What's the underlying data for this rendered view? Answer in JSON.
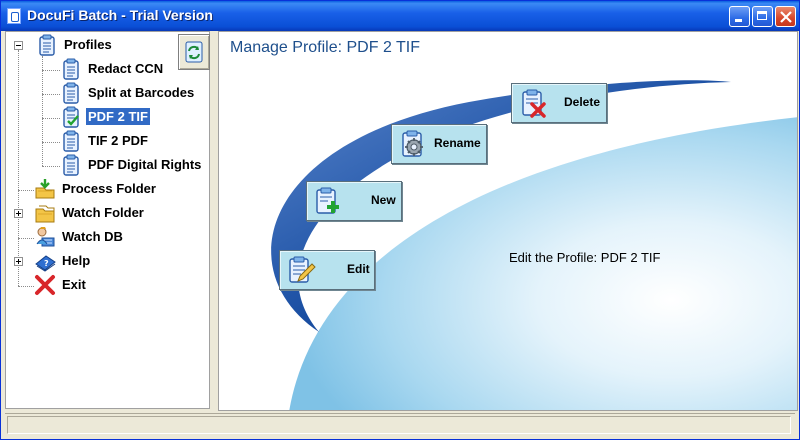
{
  "window": {
    "title": "DocuFi Batch - Trial Version"
  },
  "tree": {
    "items": [
      {
        "label": "Profiles",
        "icon": "clipboard-icon",
        "expander": "minus"
      },
      {
        "label": "Redact CCN",
        "icon": "clipboard-icon"
      },
      {
        "label": "Split at Barcodes",
        "icon": "clipboard-icon"
      },
      {
        "label": "PDF 2 TIF",
        "icon": "clipboard-check-icon",
        "selected": true
      },
      {
        "label": "TIF 2 PDF",
        "icon": "clipboard-icon"
      },
      {
        "label": "PDF Digital Rights",
        "icon": "clipboard-icon"
      },
      {
        "label": "Process Folder",
        "icon": "process-folder-icon"
      },
      {
        "label": "Watch Folder",
        "icon": "watch-folder-icon",
        "expander": "plus"
      },
      {
        "label": "Watch DB",
        "icon": "watch-db-icon"
      },
      {
        "label": "Help",
        "icon": "help-book-icon",
        "expander": "plus"
      },
      {
        "label": "Exit",
        "icon": "exit-x-icon"
      }
    ],
    "refresh_icon": "refresh-icon"
  },
  "main": {
    "title": "Manage Profile: PDF 2 TIF",
    "buttons": {
      "delete": {
        "label": "Delete",
        "icon": "delete-clipboard-icon"
      },
      "rename": {
        "label": "Rename",
        "icon": "rename-gear-icon"
      },
      "new": {
        "label": "New",
        "icon": "new-plus-icon"
      },
      "edit": {
        "label": "Edit",
        "icon": "edit-pencil-icon"
      }
    },
    "description": "Edit the Profile: PDF 2 TIF"
  },
  "colors": {
    "title_bar": "#0a4fd6",
    "selection": "#316ac5",
    "button_face": "#b7e2ee",
    "heading": "#1e4f8c",
    "swoosh": "#1a4fa3"
  }
}
